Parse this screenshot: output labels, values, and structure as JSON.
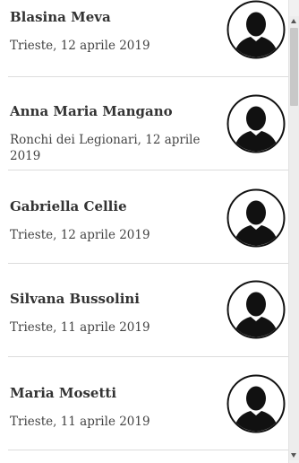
{
  "obituaries": [
    {
      "name": "Blasina Meva",
      "meta": "Trieste, 12 aprile 2019"
    },
    {
      "name": "Anna Maria Mangano",
      "meta": "Ronchi dei Legionari, 12 aprile 2019"
    },
    {
      "name": "Gabriella Cellie",
      "meta": "Trieste, 12 aprile 2019"
    },
    {
      "name": "Silvana Bussolini",
      "meta": "Trieste, 11 aprile 2019"
    },
    {
      "name": "Maria Mosetti",
      "meta": "Trieste, 11 aprile 2019"
    }
  ],
  "icons": {
    "avatar": "person-silhouette-icon",
    "scroll_up": "chevron-up-icon",
    "scroll_down": "chevron-down-icon"
  },
  "colors": {
    "separator": "#dcdcdc",
    "silhouette": "#111111"
  }
}
